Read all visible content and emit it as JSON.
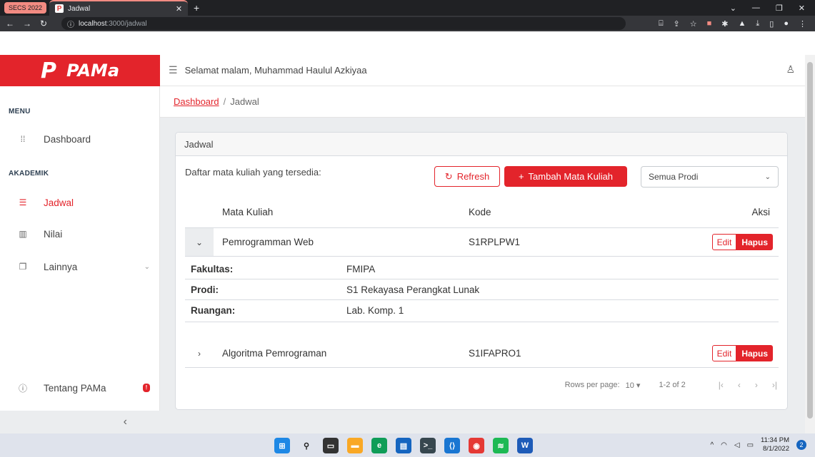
{
  "browser": {
    "tab_group": "SECS 2022",
    "tab_title": "Jadwal",
    "tab_favicon": "P",
    "url_host": "localhost",
    "url_path": ":3000/jadwal"
  },
  "sidebar": {
    "brand": "PAMa",
    "brand_mark": "P",
    "menu_title": "MENU",
    "akademik_title": "AKADEMIK",
    "items": [
      {
        "label": "Dashboard",
        "icon": "grid-icon"
      },
      {
        "label": "Jadwal",
        "icon": "list-icon"
      },
      {
        "label": "Nilai",
        "icon": "chart-icon"
      },
      {
        "label": "Lainnya",
        "icon": "copy-icon"
      }
    ],
    "about": "Tentang PAMa",
    "about_badge": "!",
    "collapse_glyph": "‹"
  },
  "header": {
    "greeting": "Selamat malam, Muhammad Haulul Azkiyaa"
  },
  "breadcrumb": {
    "home": "Dashboard",
    "separator": "/",
    "current": "Jadwal"
  },
  "card": {
    "title": "Jadwal",
    "subtitle": "Daftar mata kuliah yang tersedia:",
    "refresh_label": "Refresh",
    "add_label": "Tambah Mata Kuliah",
    "prodi_selected": "Semua Prodi"
  },
  "table": {
    "columns": [
      "Mata Kuliah",
      "Kode",
      "Aksi"
    ],
    "rows": [
      {
        "mata_kuliah": "Pemrogramman Web",
        "kode": "S1RPLPW1"
      },
      {
        "mata_kuliah": "Algoritma Pemrograman",
        "kode": "S1IFAPRO1"
      }
    ],
    "edit_label": "Edit",
    "delete_label": "Hapus",
    "details": [
      {
        "label": "Fakultas:",
        "value": "FMIPA"
      },
      {
        "label": "Prodi:",
        "value": "S1 Rekayasa Perangkat Lunak"
      },
      {
        "label": "Ruangan:",
        "value": "Lab. Komp. 1"
      }
    ]
  },
  "pagination": {
    "rows_per_page_label": "Rows per page:",
    "rows_per_page": "10",
    "range": "1-2 of 2"
  },
  "taskbar": {
    "time": "11:34 PM",
    "date": "8/1/2022",
    "notifications": "2"
  },
  "colors": {
    "accent": "#e3242b",
    "sidebar_bg": "#ffffff",
    "content_bg": "#ebedef"
  }
}
